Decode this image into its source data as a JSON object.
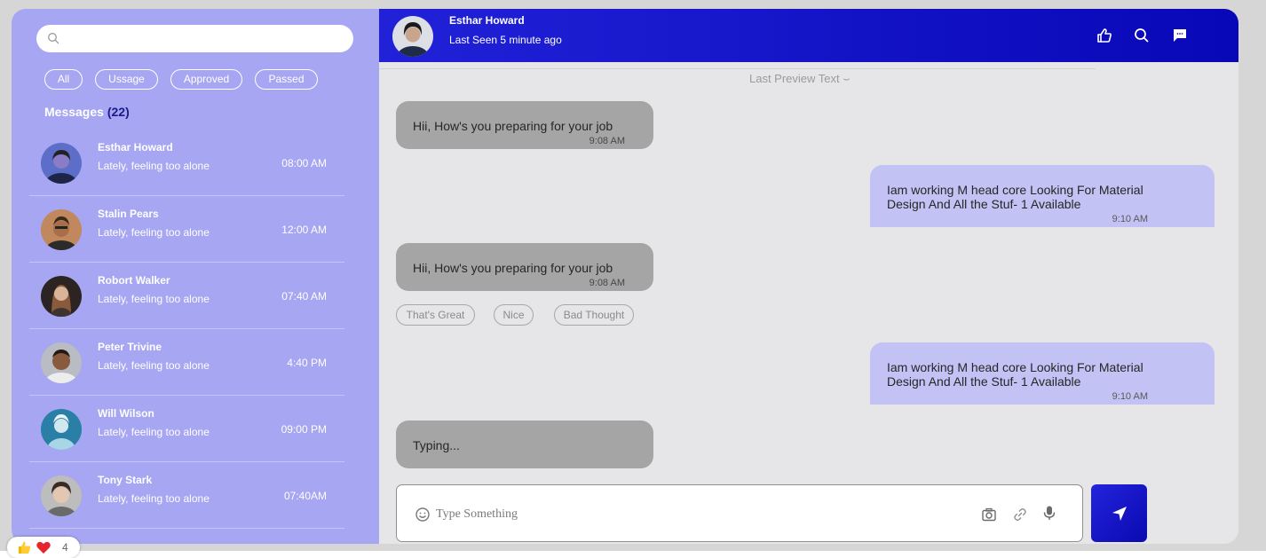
{
  "sidebar": {
    "search": {
      "placeholder": ""
    },
    "filters": [
      "All",
      "Ussage",
      "Approved",
      "Passed"
    ],
    "messages_label": "Messages",
    "messages_count": "(22)",
    "contacts": [
      {
        "name": "Esthar Howard",
        "preview": "Lately, feeling too alone",
        "time": "08:00 AM"
      },
      {
        "name": "Stalin Pears",
        "preview": "Lately, feeling too alone",
        "time": "12:00 AM"
      },
      {
        "name": "Robort Walker",
        "preview": "Lately, feeling too alone",
        "time": "07:40 AM"
      },
      {
        "name": "Peter Trivine",
        "preview": "Lately, feeling too alone",
        "time": "4:40 PM"
      },
      {
        "name": "Will Wilson",
        "preview": "Lately, feeling too alone",
        "time": "09:00 PM"
      },
      {
        "name": "Tony Stark",
        "preview": "Lately, feeling too alone",
        "time": "07:40AM"
      }
    ]
  },
  "header": {
    "name": "Esthar Howard",
    "status": "Last Seen 5 minute ago",
    "icons": [
      "thumbs-up-icon",
      "search-icon",
      "chat-icon"
    ]
  },
  "chat": {
    "preview_label": "Last Preview Text",
    "messages": [
      {
        "direction": "in",
        "text": "Hii, How's you preparing for your job",
        "time": "9:08 AM"
      },
      {
        "direction": "out",
        "text": "Iam working M head core Looking For Material Design And All the Stuf- 1 Available",
        "time": "9:10 AM"
      },
      {
        "direction": "in",
        "text": "Hii, How's you preparing for your job",
        "time": "9:08 AM"
      },
      {
        "direction": "out",
        "text": "Iam working M head core Looking For Material Design And All the Stuf- 1 Available",
        "time": "9:10 AM"
      }
    ],
    "quick_replies": [
      "That's Great",
      "Nice",
      "Bad Thought"
    ],
    "typing_text": "Typing..."
  },
  "composer": {
    "placeholder": "Type Something",
    "icons": [
      "emoji-icon",
      "camera-icon",
      "link-icon",
      "microphone-icon",
      "send-icon"
    ]
  },
  "reactions": {
    "count": "4",
    "icons": [
      "thumbs-up-emoji-icon",
      "heart-emoji-icon"
    ]
  },
  "colors": {
    "sidebar_bg": "#a6a6f2",
    "header_bg": "#1a1ad0",
    "incoming_bubble": "#a5a5a5",
    "outgoing_bubble": "#c2c2f4",
    "chat_bg": "#e6e5e8"
  }
}
